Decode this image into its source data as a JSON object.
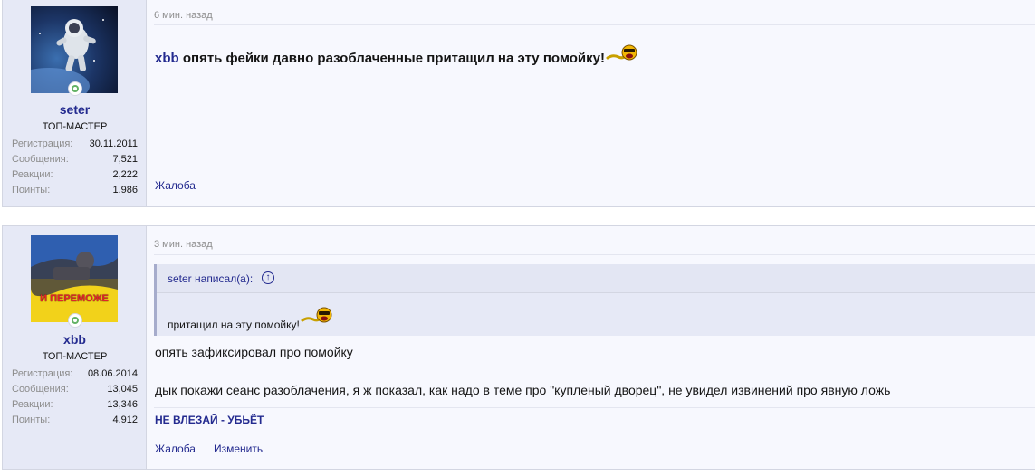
{
  "posts": [
    {
      "user": {
        "name": "seter",
        "title": "ТОП-МАСТЕР",
        "stats": [
          {
            "label": "Регистрация:",
            "value": "30.11.2011"
          },
          {
            "label": "Сообщения:",
            "value": "7,521"
          },
          {
            "label": "Реакции:",
            "value": "2,222"
          },
          {
            "label": "Поинты:",
            "value": "1.986"
          }
        ]
      },
      "date": "6 мин. назад",
      "mention": "xbb",
      "message": " опять фейки давно разоблаченные притащил на эту помойку!",
      "actions": {
        "report": "Жалоба"
      }
    },
    {
      "user": {
        "name": "xbb",
        "title": "ТОП-МАСТЕР",
        "avatar_text": "И ПЕРЕМОЖЕ",
        "stats": [
          {
            "label": "Регистрация:",
            "value": "08.06.2014"
          },
          {
            "label": "Сообщения:",
            "value": "13,045"
          },
          {
            "label": "Реакции:",
            "value": "13,346"
          },
          {
            "label": "Поинты:",
            "value": "4.912"
          }
        ]
      },
      "date": "3 мин. назад",
      "quote": {
        "author": "seter написал(а):",
        "text": "притащил на эту помойку!"
      },
      "lines": [
        "опять зафиксировал про помойку",
        "дык покажи сеанс разоблачения, я ж показал, как надо в теме про \"купленый дворец\", не увидел извинений про явную ложь"
      ],
      "signature": "НЕ ВЛЕЗАЙ - УБЬЁТ",
      "actions": {
        "report": "Жалоба",
        "edit": "Изменить"
      }
    }
  ],
  "colors": {
    "link": "#232a8f",
    "muted": "#8c8c8c",
    "panel": "#e6e9f6",
    "online": "#63b265"
  },
  "icons": [
    "online-status-icon",
    "laughing-smiley-icon",
    "arrow-up-circle-icon"
  ]
}
